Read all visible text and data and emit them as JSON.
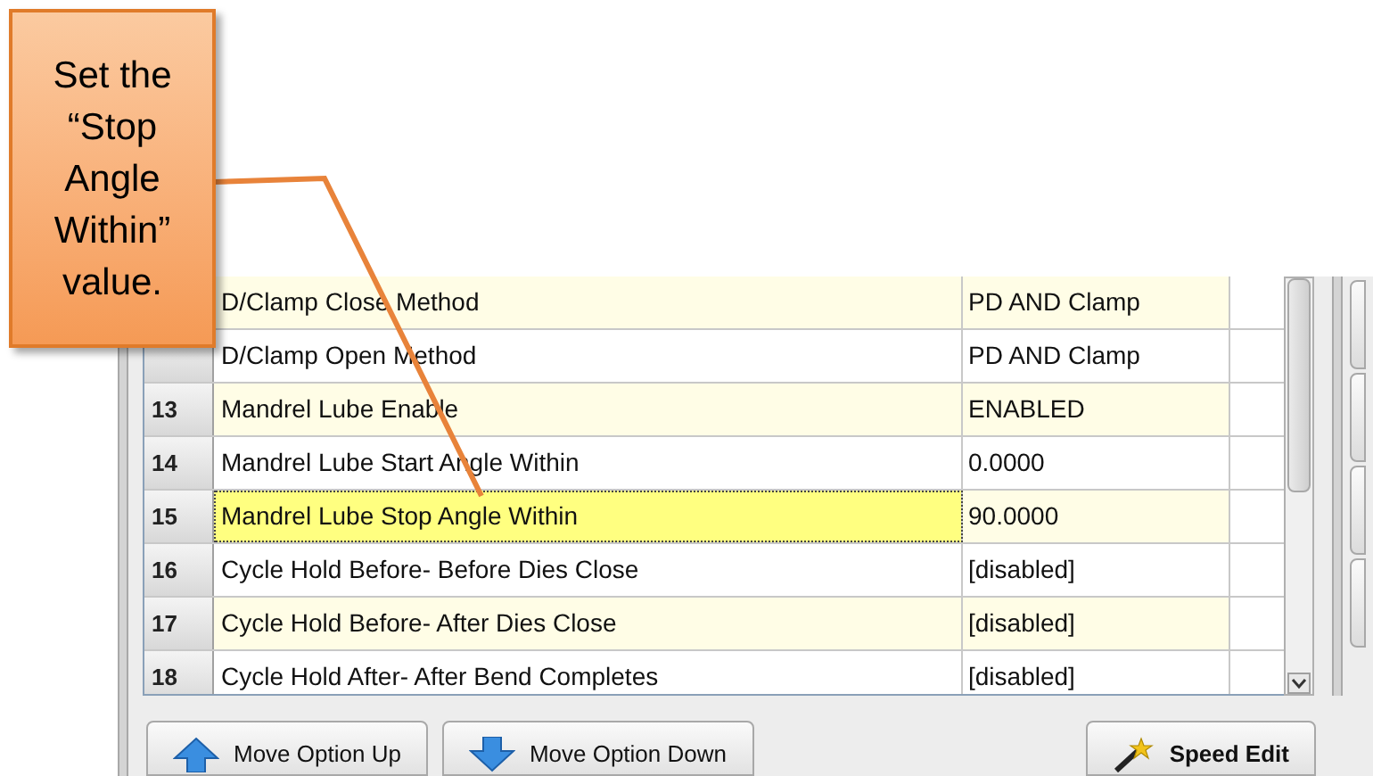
{
  "callout": {
    "text": "Set the “Stop Angle Within” value."
  },
  "table": {
    "rows": [
      {
        "name": "D/Clamp Close Method",
        "value": "PD AND Clamp",
        "selected": false
      },
      {
        "name": "D/Clamp Open Method",
        "value": "PD AND Clamp",
        "selected": false
      },
      {
        "number": "13",
        "name": "Mandrel Lube Enable",
        "value": "ENABLED",
        "selected": false
      },
      {
        "number": "14",
        "name": "Mandrel Lube Start Angle Within",
        "value": "0.0000",
        "selected": false
      },
      {
        "number": "15",
        "name": "Mandrel Lube Stop Angle Within",
        "value": "90.0000",
        "selected": true
      },
      {
        "number": "16",
        "name": "Cycle Hold Before- Before Dies Close",
        "value": "[disabled]",
        "selected": false
      },
      {
        "number": "17",
        "name": "Cycle Hold Before- After Dies Close",
        "value": "[disabled]",
        "selected": false
      },
      {
        "number": "18",
        "name": "Cycle Hold After- After Bend Completes",
        "value": "[disabled]",
        "selected": false
      }
    ]
  },
  "buttons": [
    {
      "kind": "up",
      "label": "Move Option Up"
    },
    {
      "kind": "down",
      "label": "Move Option Down"
    },
    {
      "kind": "wand",
      "label": "Speed Edit"
    }
  ]
}
